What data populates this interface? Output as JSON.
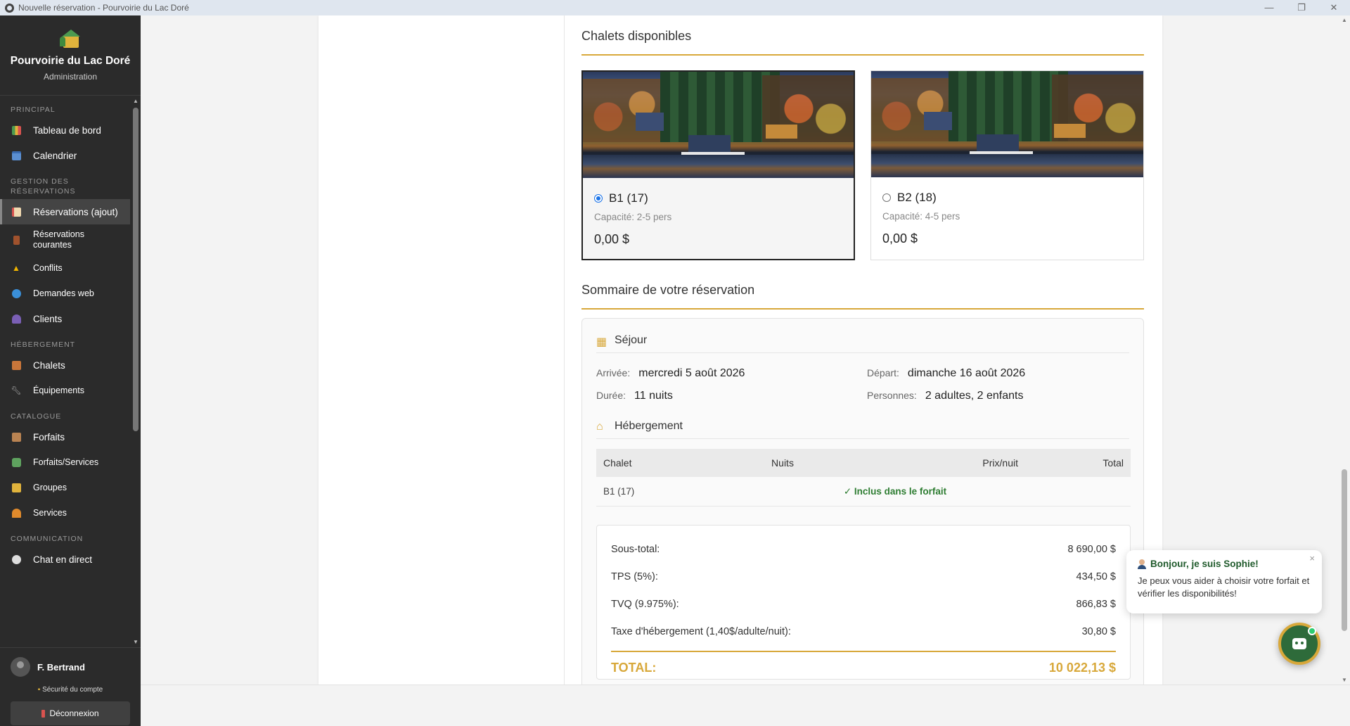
{
  "window": {
    "title": "Nouvelle réservation - Pourvoirie du Lac Doré",
    "controls": [
      "—",
      "❐",
      "✕"
    ]
  },
  "sidebar": {
    "brand_name": "Pourvoirie du Lac Doré",
    "brand_sub": "Administration",
    "sections": {
      "principal": "PRINCIPAL",
      "gestion": "GESTION DES RÉSERVATIONS",
      "hebergement": "HÉBERGEMENT",
      "catalogue": "CATALOGUE",
      "communication": "COMMUNICATION"
    },
    "items": {
      "dashboard": "Tableau de bord",
      "calendar": "Calendrier",
      "reservations_add": "Réservations (ajout)",
      "reservations_current": "Réservations courantes",
      "conflicts": "Conflits",
      "web_requests": "Demandes web",
      "clients": "Clients",
      "chalets": "Chalets",
      "equipment": "Équipements",
      "packages": "Forfaits",
      "packages_services": "Forfaits/Services",
      "groups": "Groupes",
      "services": "Services",
      "live_chat": "Chat en direct"
    },
    "user": {
      "name": "F. Bertrand",
      "security": "Sécurité du compte",
      "logout": "Déconnexion"
    }
  },
  "main": {
    "chalets_title": "Chalets disponibles",
    "chalets": [
      {
        "name": "B1 (17)",
        "capacity": "Capacité: 2-5 pers",
        "price": "0,00 $",
        "selected": true
      },
      {
        "name": "B2 (18)",
        "capacity": "Capacité: 4-5 pers",
        "price": "0,00 $",
        "selected": false
      }
    ],
    "summary_title": "Sommaire de votre réservation",
    "stay": {
      "title": "Séjour",
      "arrival_label": "Arrivée:",
      "arrival": "mercredi 5 août 2026",
      "departure_label": "Départ:",
      "departure": "dimanche 16 août 2026",
      "duration_label": "Durée:",
      "duration": "11 nuits",
      "persons_label": "Personnes:",
      "persons": "2 adultes, 2 enfants"
    },
    "lodging": {
      "title": "Hébergement",
      "headers": [
        "Chalet",
        "Nuits",
        "Prix/nuit",
        "Total"
      ],
      "row": {
        "chalet": "B1 (17)",
        "note": "✓ Inclus dans le forfait"
      }
    },
    "totals": {
      "subtotal_label": "Sous-total:",
      "subtotal": "8 690,00 $",
      "tps_label": "TPS (5%):",
      "tps": "434,50 $",
      "tvq_label": "TVQ (9.975%):",
      "tvq": "866,83 $",
      "lodging_tax_label": "Taxe d'hébergement (1,40$/adulte/nuit):",
      "lodging_tax": "30,80 $",
      "total_label": "TOTAL:",
      "total": "10 022,13 $"
    }
  },
  "chat": {
    "greeting": "Bonjour, je suis Sophie!",
    "message": "Je peux vous aider à choisir votre forfait et vérifier les disponibilités!",
    "close": "×"
  },
  "colors": {
    "accent": "#d8a83a",
    "sidebar": "#2b2b2b",
    "included": "#2e7d32",
    "bot": "#2e6b3a"
  }
}
